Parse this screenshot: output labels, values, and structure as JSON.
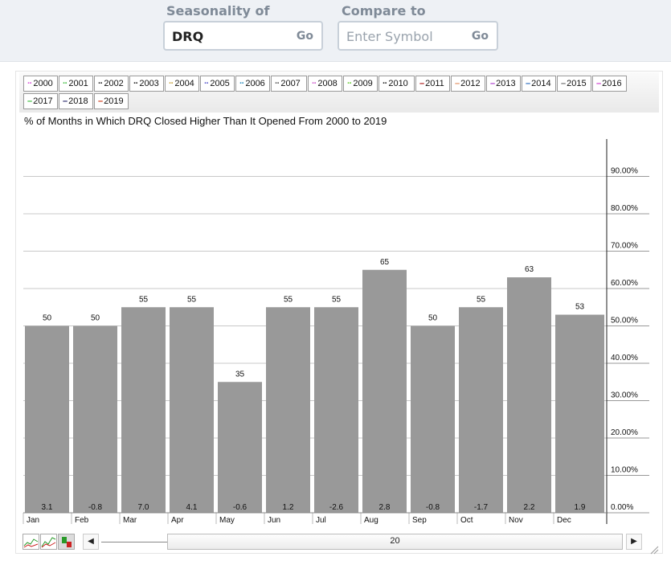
{
  "search": {
    "seasonality_label": "Seasonality of",
    "seasonality_value": "DRQ",
    "seasonality_go": "Go",
    "compare_label": "Compare to",
    "compare_placeholder": "Enter Symbol",
    "compare_go": "Go"
  },
  "legend": [
    {
      "label": "2000",
      "color": "#d94fd9",
      "style": "dot"
    },
    {
      "label": "2001",
      "color": "#3fbf3f",
      "style": "dot"
    },
    {
      "label": "2002",
      "color": "#222222",
      "style": "dot"
    },
    {
      "label": "2003",
      "color": "#222222",
      "style": "dot"
    },
    {
      "label": "2004",
      "color": "#c8a33c",
      "style": "dot"
    },
    {
      "label": "2005",
      "color": "#5a5acc",
      "style": "dot"
    },
    {
      "label": "2006",
      "color": "#2f8fbf",
      "style": "dot"
    },
    {
      "label": "2007",
      "color": "#555555",
      "style": "dot"
    },
    {
      "label": "2008",
      "color": "#cc55cc",
      "style": "dot"
    },
    {
      "label": "2009",
      "color": "#66cc33",
      "style": "dot"
    },
    {
      "label": "2010",
      "color": "#222222",
      "style": "dot"
    },
    {
      "label": "2011",
      "color": "#aa1111",
      "style": "dash"
    },
    {
      "label": "2012",
      "color": "#e08a5a",
      "style": "dash"
    },
    {
      "label": "2013",
      "color": "#aa33cc",
      "style": "dash"
    },
    {
      "label": "2014",
      "color": "#2266bb",
      "style": "dash"
    },
    {
      "label": "2015",
      "color": "#666666",
      "style": "dash"
    },
    {
      "label": "2016",
      "color": "#cc33cc",
      "style": "dash"
    },
    {
      "label": "2017",
      "color": "#33bb33",
      "style": "dash"
    },
    {
      "label": "2018",
      "color": "#222266",
      "style": "dash"
    },
    {
      "label": "2019",
      "color": "#cc3311",
      "style": "dash"
    }
  ],
  "navigator": {
    "value_label": "20",
    "left_arrow": "◀",
    "right_arrow": "▶"
  },
  "chart_data": {
    "type": "bar",
    "title": "% of Months in Which DRQ Closed Higher Than It Opened From 2000 to 2019",
    "categories": [
      "Jan",
      "Feb",
      "Mar",
      "Apr",
      "May",
      "Jun",
      "Jul",
      "Aug",
      "Sep",
      "Oct",
      "Nov",
      "Dec"
    ],
    "values": [
      50,
      50,
      55,
      55,
      35,
      55,
      55,
      65,
      50,
      55,
      63,
      53
    ],
    "bar_labels": [
      "50",
      "50",
      "55",
      "55",
      "35",
      "55",
      "55",
      "65",
      "50",
      "55",
      "63",
      "53"
    ],
    "avg_change_labels": [
      "3.1",
      "-0.8",
      "7.0",
      "4.1",
      "-0.6",
      "1.2",
      "-2.6",
      "2.8",
      "-0.8",
      "-1.7",
      "2.2",
      "1.9"
    ],
    "y_ticks": [
      "0.00%",
      "10.00%",
      "20.00%",
      "30.00%",
      "40.00%",
      "50.00%",
      "60.00%",
      "70.00%",
      "80.00%",
      "90.00%"
    ],
    "ylim": [
      0,
      100
    ],
    "bar_color": "#999999",
    "axis_position": "right",
    "grid": true
  }
}
